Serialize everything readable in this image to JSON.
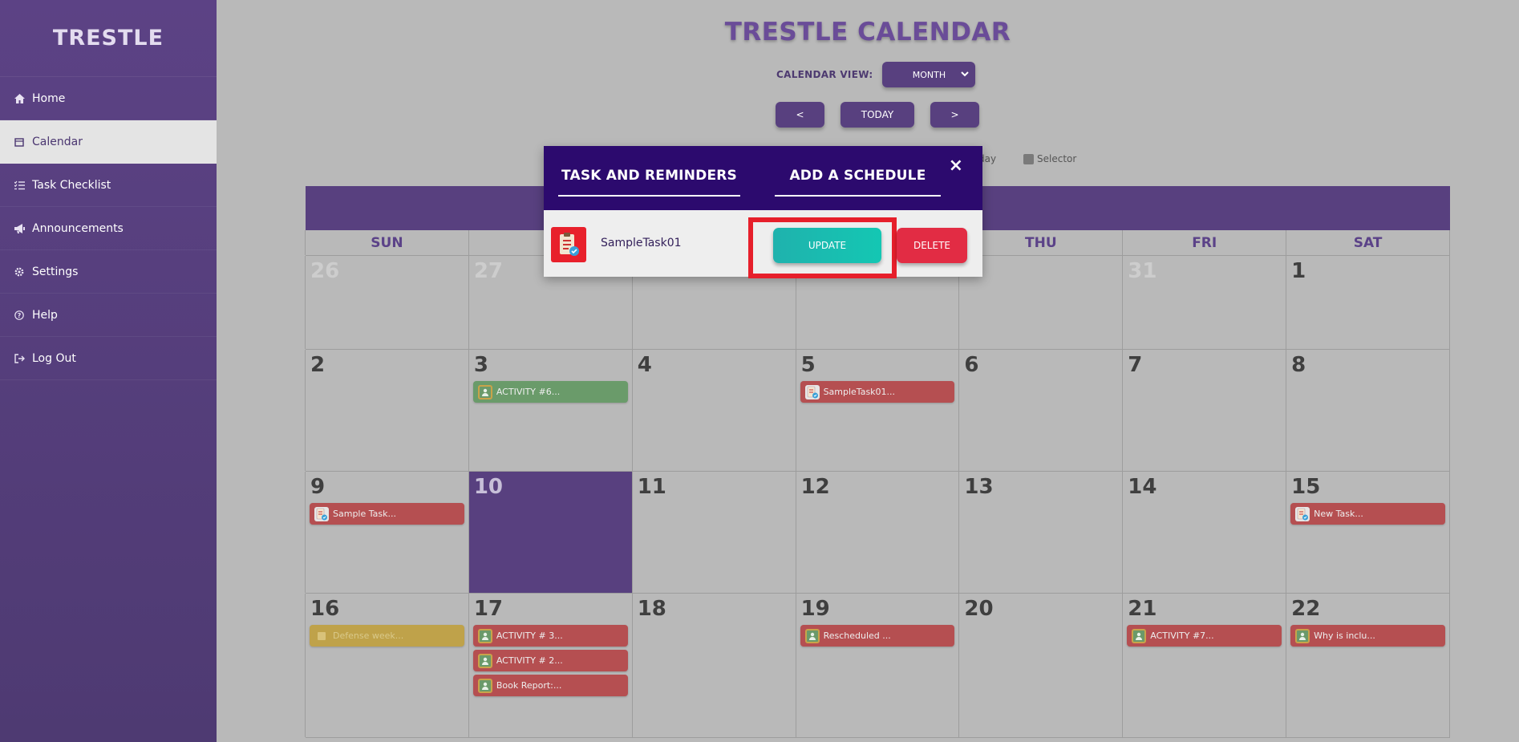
{
  "sidebar": {
    "brand": "TRESTLE",
    "items": [
      {
        "label": "Home",
        "icon": "home-icon"
      },
      {
        "label": "Calendar",
        "icon": "calendar-icon"
      },
      {
        "label": "Task Checklist",
        "icon": "checklist-icon"
      },
      {
        "label": "Announcements",
        "icon": "megaphone-icon"
      },
      {
        "label": "Settings",
        "icon": "gear-icon"
      },
      {
        "label": "Help",
        "icon": "question-icon"
      },
      {
        "label": "Log Out",
        "icon": "logout-icon"
      }
    ],
    "active": "Calendar"
  },
  "header": {
    "title": "TRESTLE CALENDAR",
    "view_label": "CALENDAR VIEW:",
    "view_selected": "MONTH",
    "prev": "<",
    "today": "TODAY",
    "next": ">"
  },
  "legend": {
    "partial_label": "day",
    "selector_label": "Selector"
  },
  "calendar": {
    "weekdays": [
      "SUN",
      "M",
      "",
      "",
      "THU",
      "FRI",
      "SAT"
    ],
    "weeks": [
      [
        {
          "day": "26",
          "muted": true,
          "events": []
        },
        {
          "day": "27",
          "muted": true,
          "events": []
        },
        {
          "day": "",
          "muted": true,
          "events": []
        },
        {
          "day": "",
          "muted": true,
          "events": []
        },
        {
          "day": "",
          "muted": true,
          "events": []
        },
        {
          "day": "31",
          "muted": true,
          "events": []
        },
        {
          "day": "1",
          "muted": false,
          "events": []
        }
      ],
      [
        {
          "day": "2",
          "events": []
        },
        {
          "day": "3",
          "events": [
            {
              "label": "ACTIVITY #6...",
              "kind": "class",
              "color": "green"
            }
          ]
        },
        {
          "day": "4",
          "events": []
        },
        {
          "day": "5",
          "events": [
            {
              "label": "SampleTask01...",
              "kind": "task",
              "color": "red"
            }
          ]
        },
        {
          "day": "6",
          "events": []
        },
        {
          "day": "7",
          "events": []
        },
        {
          "day": "8",
          "events": []
        }
      ],
      [
        {
          "day": "9",
          "events": [
            {
              "label": "Sample Task...",
              "kind": "task",
              "color": "red"
            }
          ]
        },
        {
          "day": "10",
          "today": true,
          "events": []
        },
        {
          "day": "11",
          "events": []
        },
        {
          "day": "12",
          "events": []
        },
        {
          "day": "13",
          "events": []
        },
        {
          "day": "14",
          "events": []
        },
        {
          "day": "15",
          "events": [
            {
              "label": "New Task...",
              "kind": "task",
              "color": "red"
            }
          ]
        }
      ],
      [
        {
          "day": "16",
          "events": [
            {
              "label": "Defense week...",
              "kind": "announcement",
              "color": "yellow"
            }
          ]
        },
        {
          "day": "17",
          "events": [
            {
              "label": "ACTIVITY # 3...",
              "kind": "class",
              "color": "red"
            },
            {
              "label": "ACTIVITY # 2...",
              "kind": "class",
              "color": "red"
            },
            {
              "label": "Book Report:...",
              "kind": "class",
              "color": "red"
            }
          ]
        },
        {
          "day": "18",
          "events": []
        },
        {
          "day": "19",
          "events": [
            {
              "label": "Rescheduled ...",
              "kind": "class",
              "color": "red"
            }
          ]
        },
        {
          "day": "20",
          "events": []
        },
        {
          "day": "21",
          "events": [
            {
              "label": "ACTIVITY #7...",
              "kind": "class",
              "color": "red"
            }
          ]
        },
        {
          "day": "22",
          "events": [
            {
              "label": "Why is inclu...",
              "kind": "class",
              "color": "red"
            }
          ]
        }
      ]
    ]
  },
  "modal": {
    "tab1": "TASK AND REMINDERS",
    "tab2": "ADD A SCHEDULE",
    "close": "×",
    "task_name": "SampleTask01",
    "update": "UPDATE",
    "delete": "DELETE"
  },
  "colors": {
    "primary": "#58407f",
    "modal_header": "#2c0a6e",
    "update": "#17bdb0",
    "delete": "#e22c44",
    "highlight": "#e61f2b"
  }
}
